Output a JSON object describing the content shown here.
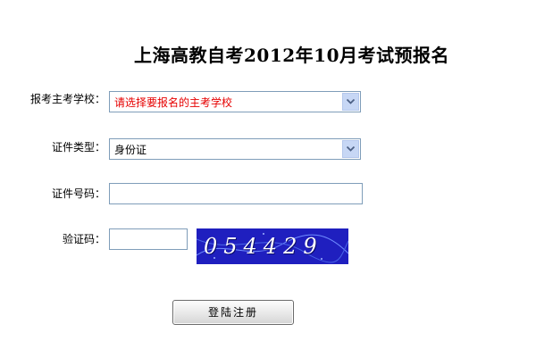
{
  "page": {
    "title": "上海高教自考2012年10月考试预报名"
  },
  "form": {
    "school": {
      "label": "报考主考学校：",
      "selected": "请选择要报名的主考学校",
      "selected_color": "#e60000"
    },
    "id_type": {
      "label": "证件类型：",
      "selected": "身份证"
    },
    "id_number": {
      "label": "证件号码：",
      "value": ""
    },
    "captcha": {
      "label": "验证码：",
      "value": "",
      "image_text": "054429"
    },
    "submit": {
      "label": "登陆注册"
    }
  },
  "colors": {
    "captcha_background": "#1f1fbf",
    "input_border": "#7f9db9",
    "dropdown_button": "#c7d7f5"
  },
  "icons": {
    "dropdown": "chevron-down-icon"
  }
}
